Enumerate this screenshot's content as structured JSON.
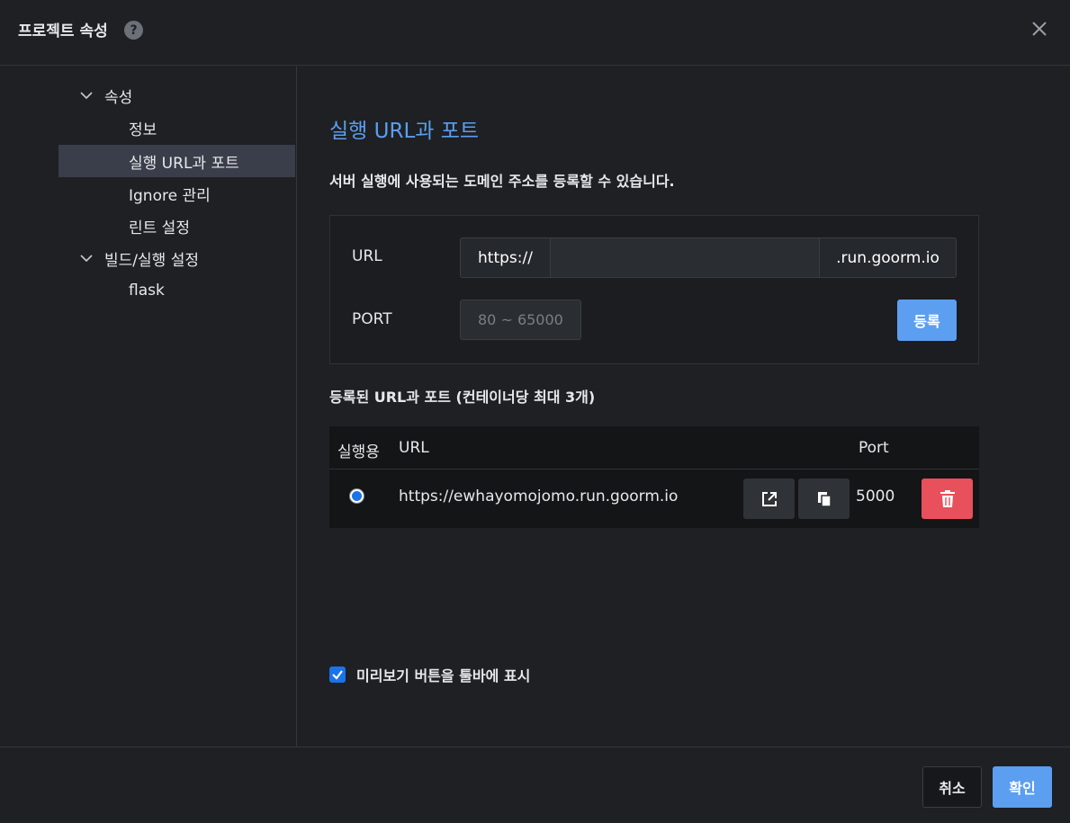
{
  "dialog": {
    "title": "프로젝트 속성",
    "help_icon": "question-circle-icon",
    "close_icon": "close-icon"
  },
  "sidebar": {
    "groups": [
      {
        "label": "속성",
        "expanded": true,
        "items": [
          "정보",
          "실행 URL과 포트",
          "Ignore 관리",
          "린트 설정"
        ]
      },
      {
        "label": "빌드/실행 설정",
        "expanded": true,
        "items": [
          "flask"
        ]
      }
    ],
    "active_item": "실행 URL과 포트"
  },
  "main": {
    "section_title": "실행 URL과 포트",
    "description": "서버 실행에 사용되는 도메인 주소를 등록할 수 있습니다.",
    "form": {
      "url_label": "URL",
      "url_prefix": "https://",
      "url_value": "",
      "url_suffix": ".run.goorm.io",
      "port_label": "PORT",
      "port_placeholder": "80 ~ 65000",
      "register_label": "등록"
    },
    "registered_title": "등록된 URL과 포트 (컨테이너당 최대 3개)",
    "table": {
      "headers": [
        "실행용",
        "URL",
        "Port"
      ],
      "rows": [
        {
          "selected": true,
          "url": "https://ewhayomojomo.run.goorm.io",
          "port": "5000"
        }
      ]
    },
    "preview_checkbox": {
      "checked": true,
      "label": "미리보기 버튼을 툴바에 표시"
    }
  },
  "footer": {
    "cancel_label": "취소",
    "ok_label": "확인"
  },
  "colors": {
    "accent": "#5c9ef0",
    "danger": "#e8505b",
    "background": "#1e2024"
  }
}
